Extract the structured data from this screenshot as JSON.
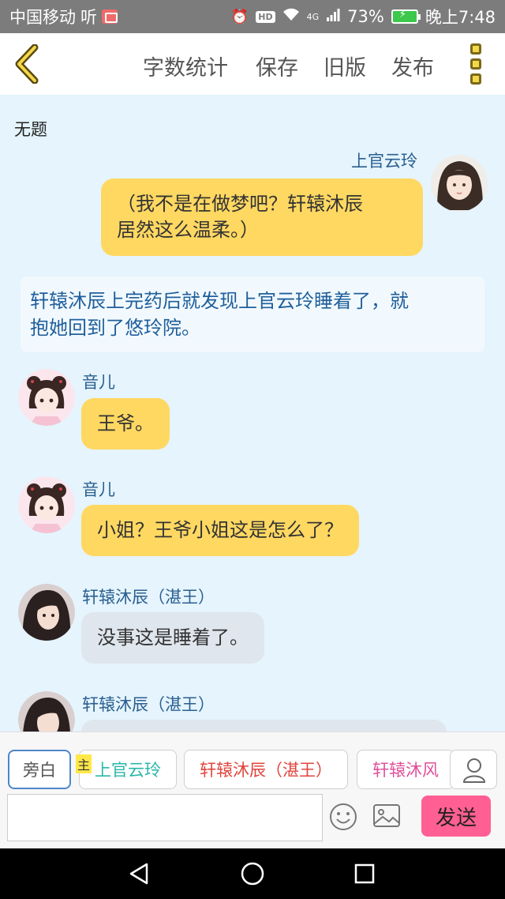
{
  "status_bar": {
    "carrier": "中国移动",
    "carrier_suffix": "听",
    "network": "4G",
    "hd": "HD",
    "battery": "73%",
    "time": "晚上7:48"
  },
  "toolbar": {
    "word_count": "字数统计",
    "save": "保存",
    "old_version": "旧版",
    "publish": "发布"
  },
  "document": {
    "title": "无题"
  },
  "messages": [
    {
      "speaker": "上官云玲",
      "text": "（我不是在做梦吧？轩辕沐辰居然这么温柔。）"
    },
    {
      "type": "narration",
      "text": "轩辕沐辰上完药后就发现上官云玲睡着了，就抱她回到了悠玲院。"
    },
    {
      "speaker": "音儿",
      "text": "王爷。"
    },
    {
      "speaker": "音儿",
      "text": "小姐？王爷小姐这是怎么了？"
    },
    {
      "speaker": "轩辕沐辰（湛王）",
      "text": "没事这是睡着了。"
    },
    {
      "speaker": "轩辕沐辰（湛王）",
      "text": ""
    }
  ],
  "message_lines": {
    "m1_line1": "（我不是在做梦吧？轩辕沐辰",
    "m1_line2": "居然这么温柔。）",
    "narration_line1": "轩辕沐辰上完药后就发现上官云玲睡着了，就",
    "narration_line2": "抱她回到了悠玲院。"
  },
  "characters": {
    "items": [
      {
        "label": "旁白",
        "color": "#555555"
      },
      {
        "label": "上官云玲",
        "color": "#2ab7a9",
        "tag": "主"
      },
      {
        "label": "轩辕沐辰（湛王）",
        "color": "#e0453e"
      },
      {
        "label": "轩辕沐风",
        "color": "#e0509a"
      }
    ]
  },
  "composer": {
    "input_value": "",
    "send": "发送"
  },
  "icons": {
    "back": "chevron-left-icon",
    "more": "more-vertical-icon",
    "person": "person-icon",
    "emoji": "emoji-icon",
    "image": "image-icon",
    "nav_back": "triangle-back-icon",
    "nav_home": "circle-home-icon",
    "nav_recent": "square-recent-icon"
  },
  "colors": {
    "chat_bg": "#e5f4fd",
    "bubble_yellow": "#ffd862",
    "bubble_gray": "#dfe6ed",
    "send_button": "#ff5f93",
    "accent_yellow": "#f5d74a"
  }
}
